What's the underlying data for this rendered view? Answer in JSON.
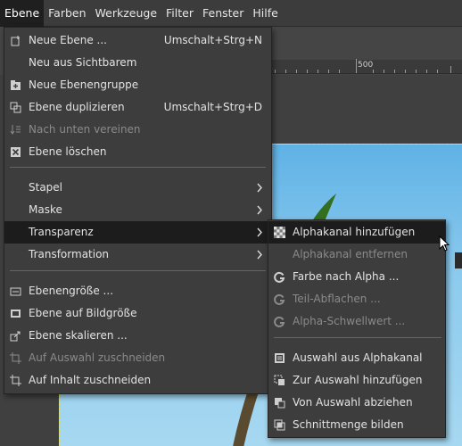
{
  "menubar": {
    "items": [
      "Ebene",
      "Farben",
      "Werkzeuge",
      "Filter",
      "Fenster",
      "Hilfe"
    ],
    "active_index": 0
  },
  "ruler": {
    "label": "500"
  },
  "layer_menu": {
    "items": [
      {
        "label": "Neue Ebene ...",
        "shortcut": "Umschalt+Strg+N",
        "icon": "new-layer-icon",
        "enabled": true
      },
      {
        "label": "Neu aus Sichtbarem",
        "shortcut": "",
        "icon": "",
        "enabled": true
      },
      {
        "label": "Neue Ebenengruppe",
        "shortcut": "",
        "icon": "new-layer-group-icon",
        "enabled": true
      },
      {
        "label": "Ebene duplizieren",
        "shortcut": "Umschalt+Strg+D",
        "icon": "duplicate-layer-icon",
        "enabled": true
      },
      {
        "label": "Nach unten vereinen",
        "shortcut": "",
        "icon": "merge-down-icon",
        "enabled": false
      },
      {
        "label": "Ebene löschen",
        "shortcut": "",
        "icon": "delete-layer-icon",
        "enabled": true
      },
      {
        "label": "Stapel",
        "submenu": true,
        "icon": "",
        "enabled": true
      },
      {
        "label": "Maske",
        "submenu": true,
        "icon": "",
        "enabled": true
      },
      {
        "label": "Transparenz",
        "submenu": true,
        "icon": "",
        "enabled": true,
        "highlighted": true
      },
      {
        "label": "Transformation",
        "submenu": true,
        "icon": "",
        "enabled": true
      },
      {
        "label": "Ebenengröße ...",
        "shortcut": "",
        "icon": "layer-size-icon",
        "enabled": true
      },
      {
        "label": "Ebene auf Bildgröße",
        "shortcut": "",
        "icon": "layer-to-image-size-icon",
        "enabled": true
      },
      {
        "label": "Ebene skalieren ...",
        "shortcut": "",
        "icon": "scale-layer-icon",
        "enabled": true
      },
      {
        "label": "Auf Auswahl zuschneiden",
        "shortcut": "",
        "icon": "crop-to-selection-icon",
        "enabled": false
      },
      {
        "label": "Auf Inhalt zuschneiden",
        "shortcut": "",
        "icon": "crop-to-content-icon",
        "enabled": true
      }
    ]
  },
  "transparency_menu": {
    "items": [
      {
        "label": "Alphakanal hinzufügen",
        "icon": "checkerboard-icon",
        "enabled": true,
        "highlighted": true
      },
      {
        "label": "Alphakanal entfernen",
        "icon": "",
        "enabled": false
      },
      {
        "label": "Farbe nach Alpha ...",
        "icon": "gegl-icon",
        "enabled": true
      },
      {
        "label": "Teil-Abflachen ...",
        "icon": "gegl-icon",
        "enabled": false
      },
      {
        "label": "Alpha-Schwellwert ...",
        "icon": "gegl-icon",
        "enabled": false
      },
      {
        "label": "Auswahl aus Alphakanal",
        "icon": "selection-from-alpha-icon",
        "enabled": true
      },
      {
        "label": "Zur Auswahl hinzufügen",
        "icon": "add-to-selection-icon",
        "enabled": true
      },
      {
        "label": "Von Auswahl abziehen",
        "icon": "subtract-from-selection-icon",
        "enabled": true
      },
      {
        "label": "Schnittmenge bilden",
        "icon": "intersect-selection-icon",
        "enabled": true
      }
    ]
  },
  "colors": {
    "menu_bg": "#3d3d3d",
    "highlight_bg": "#1c1c1c",
    "text": "#e3e3e3",
    "disabled_text": "#8a8a8a",
    "sky": "#8dcbee"
  }
}
